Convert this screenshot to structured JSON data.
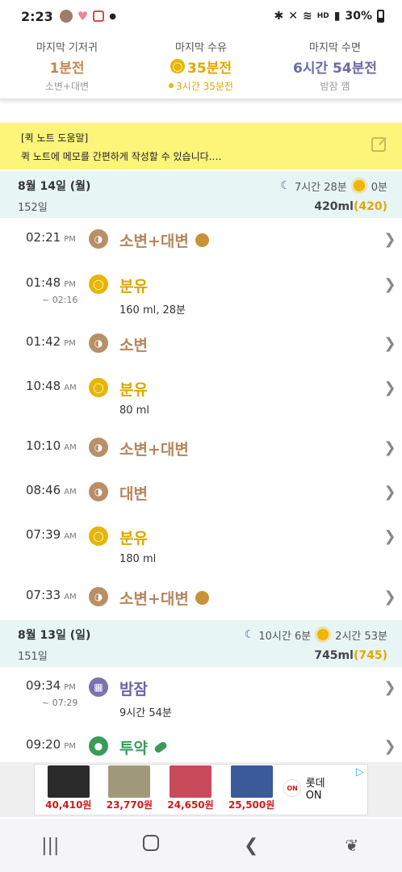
{
  "statusbar": {
    "time": "2:23",
    "right_text": "30%",
    "icons": [
      "avatar-icon",
      "heart-icon",
      "calendar-icon",
      "notification-dot",
      "bluetooth-icon",
      "mute-icon",
      "wifi-icon",
      "signal-icon",
      "battery-icon"
    ],
    "hd_label": "HD"
  },
  "summary": {
    "diaper": {
      "title": "마지막 기저귀",
      "value": "1분전",
      "sub": "소변+대변"
    },
    "feed": {
      "title": "마지막 수유",
      "value": "35분전",
      "sub": "3시간 35분전"
    },
    "sleep": {
      "title": "마지막 수면",
      "value": "6시간 54분전",
      "sub": "밤잠 깸"
    }
  },
  "quicknote": {
    "title": "[퀵 노트 도움말]",
    "body": "퀵 노트에 메모를 간편하게 작성할 수 있습니다.…"
  },
  "days": [
    {
      "date": "8월 14일 (월)",
      "age": "152일",
      "night_sleep": "7시간 28분",
      "day_sleep": "0분",
      "volume": "420ml",
      "volume_paren": "420"
    },
    {
      "date": "8월 13일 (일)",
      "age": "151일",
      "night_sleep": "10시간 6분",
      "day_sleep": "2시간 53분",
      "volume": "745ml",
      "volume_paren": "745"
    }
  ],
  "entries": [
    {
      "time": "02:21",
      "ampm": "PM",
      "type": "diaper",
      "label": "소변+대변",
      "poop": true
    },
    {
      "time": "01:48",
      "ampm": "PM",
      "end": "~ 02:16",
      "type": "bottle",
      "label": "분유",
      "detail": "160 ml, 28분"
    },
    {
      "time": "01:42",
      "ampm": "PM",
      "type": "diaper",
      "label": "소변"
    },
    {
      "time": "10:48",
      "ampm": "AM",
      "type": "bottle",
      "label": "분유",
      "detail": "80 ml"
    },
    {
      "time": "10:10",
      "ampm": "AM",
      "type": "diaper",
      "label": "소변+대변"
    },
    {
      "time": "08:46",
      "ampm": "AM",
      "type": "diaper",
      "label": "대변"
    },
    {
      "time": "07:39",
      "ampm": "AM",
      "type": "bottle",
      "label": "분유",
      "detail": "180 ml"
    },
    {
      "time": "07:33",
      "ampm": "AM",
      "type": "diaper",
      "label": "소변+대변",
      "poop": true
    },
    {
      "time": "09:34",
      "ampm": "PM",
      "end": "~ 07:29",
      "type": "sleep",
      "label": "밤잠",
      "detail": "9시간 54분"
    },
    {
      "time": "09:20",
      "ampm": "PM",
      "type": "med",
      "label": "투약",
      "pill": true
    }
  ],
  "ad": {
    "prices": [
      "40,410원",
      "23,770원",
      "24,650원",
      "25,500원"
    ],
    "brand": "롯데ON",
    "brand_logo": "ON"
  },
  "colors": {
    "accent_brown": "#b5865e",
    "accent_gold": "#e0a800",
    "accent_purple": "#6a64a6",
    "accent_green": "#3a9a5a",
    "quicknote_bg": "#fdf47a",
    "datehdr_bg": "#e8f5f5"
  }
}
